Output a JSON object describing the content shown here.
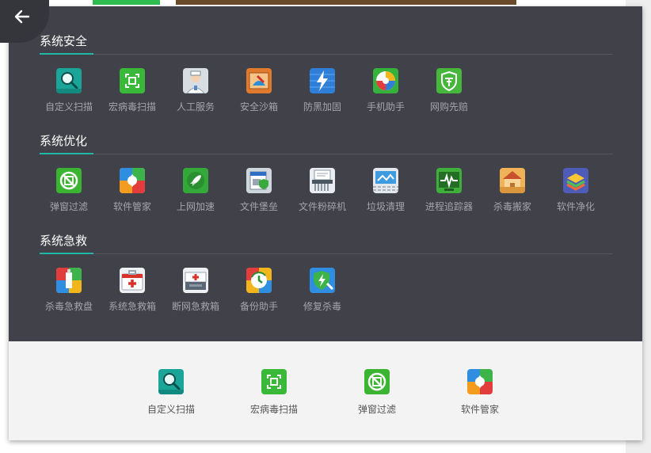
{
  "sections": [
    {
      "title": "系统安全",
      "items": [
        {
          "label": "自定义扫描",
          "icon": "magnifier-icon"
        },
        {
          "label": "宏病毒扫描",
          "icon": "macro-scan-icon"
        },
        {
          "label": "人工服务",
          "icon": "doctor-icon"
        },
        {
          "label": "安全沙箱",
          "icon": "sandbox-icon"
        },
        {
          "label": "防黑加固",
          "icon": "lightning-shield-icon"
        },
        {
          "label": "手机助手",
          "icon": "phone-assistant-icon"
        },
        {
          "label": "网购先赔",
          "icon": "shopping-shield-icon"
        }
      ]
    },
    {
      "title": "系统优化",
      "items": [
        {
          "label": "弹窗过滤",
          "icon": "popup-filter-icon"
        },
        {
          "label": "软件管家",
          "icon": "software-manager-icon"
        },
        {
          "label": "上网加速",
          "icon": "rocket-icon"
        },
        {
          "label": "文件堡垒",
          "icon": "file-fortress-icon"
        },
        {
          "label": "文件粉碎机",
          "icon": "shredder-icon"
        },
        {
          "label": "垃圾清理",
          "icon": "cleanup-icon"
        },
        {
          "label": "进程追踪器",
          "icon": "process-tracker-icon"
        },
        {
          "label": "杀毒搬家",
          "icon": "house-move-icon"
        },
        {
          "label": "软件净化",
          "icon": "layers-icon"
        }
      ]
    },
    {
      "title": "系统急救",
      "items": [
        {
          "label": "杀毒急救盘",
          "icon": "rescue-usb-icon"
        },
        {
          "label": "系统急救箱",
          "icon": "first-aid-kit-icon"
        },
        {
          "label": "断网急救箱",
          "icon": "offline-aid-kit-icon"
        },
        {
          "label": "备份助手",
          "icon": "backup-icon"
        },
        {
          "label": "修复杀毒",
          "icon": "repair-shield-icon"
        }
      ]
    }
  ],
  "quick_access": [
    {
      "label": "自定义扫描",
      "icon": "magnifier-icon"
    },
    {
      "label": "宏病毒扫描",
      "icon": "macro-scan-icon"
    },
    {
      "label": "弹窗过滤",
      "icon": "popup-filter-icon"
    },
    {
      "label": "软件管家",
      "icon": "software-manager-icon"
    }
  ],
  "colors": {
    "panel_dark": "#414149",
    "accent": "#1fb8a7",
    "label": "#a4a4ab"
  }
}
